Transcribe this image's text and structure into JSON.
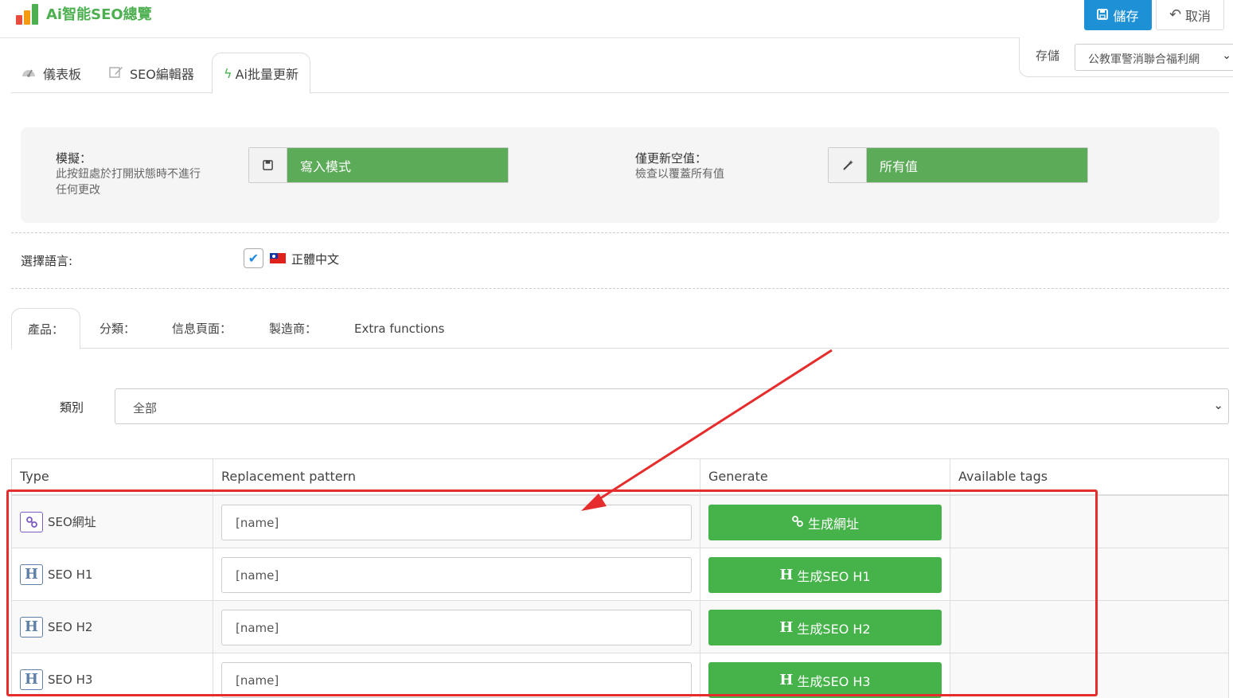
{
  "header": {
    "title": "Ai智能SEO總覽",
    "save_label": "儲存",
    "cancel_label": "取消"
  },
  "store": {
    "label": "存儲",
    "selected": "公教軍警消聯合福利網"
  },
  "main_tabs": [
    {
      "label": "儀表板",
      "icon": "dashboard-icon"
    },
    {
      "label": "SEO編輯器",
      "icon": "edit-icon"
    },
    {
      "label": "Ai批量更新",
      "icon": "bolt-icon",
      "active": true
    }
  ],
  "settings": {
    "simulate": {
      "title": "模擬：",
      "desc_line1": "此按鈕處於打開狀態時不進行",
      "desc_line2": "任何更改",
      "toggle_label": "寫入模式"
    },
    "only_empty": {
      "title": "僅更新空值：",
      "desc": "檢查以覆蓋所有值",
      "toggle_label": "所有值"
    }
  },
  "language": {
    "label": "選擇語言:",
    "name": "正體中文",
    "checked": true
  },
  "sub_tabs": [
    {
      "label": "產品：",
      "active": true
    },
    {
      "label": "分類："
    },
    {
      "label": "信息頁面："
    },
    {
      "label": "製造商："
    },
    {
      "label": "Extra functions"
    }
  ],
  "category": {
    "label": "類別",
    "selected": "全部"
  },
  "table": {
    "headers": [
      "Type",
      "Replacement pattern",
      "Generate",
      "Available tags"
    ],
    "rows": [
      {
        "type": "SEO網址",
        "icon": "link-icon",
        "pattern": "[name]",
        "button": "生成網址"
      },
      {
        "type": "SEO H1",
        "icon": "h-icon",
        "pattern": "[name]",
        "button": "生成SEO H1"
      },
      {
        "type": "SEO H2",
        "icon": "h-icon",
        "pattern": "[name]",
        "button": "生成SEO H2"
      },
      {
        "type": "SEO H3",
        "icon": "h-icon",
        "pattern": "[name]",
        "button": "生成SEO H3"
      }
    ]
  },
  "colors": {
    "brand_green": "#4caf50",
    "toggle_green": "#5cab58",
    "button_green": "#46b34a",
    "save_blue": "#1e90d6",
    "annotation_red": "#e62d2d"
  }
}
